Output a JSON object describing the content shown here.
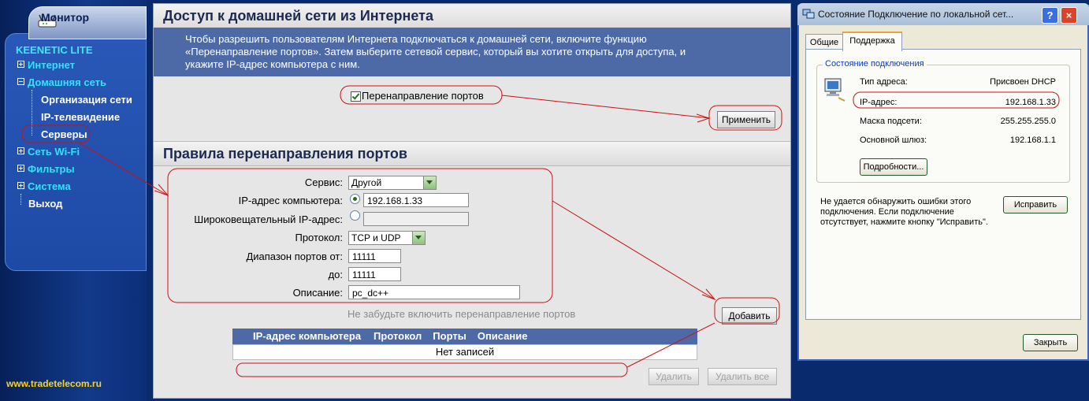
{
  "sidebar": {
    "monitor_label": "Монитор",
    "brand": "KEENETIC LITE",
    "items": [
      {
        "label": "Интернет",
        "expander": "+"
      },
      {
        "label": "Домашняя сеть",
        "expander": "-"
      },
      {
        "label": "Организация сети"
      },
      {
        "label": "IP-телевидение"
      },
      {
        "label": "Серверы"
      },
      {
        "label": "Сеть Wi-Fi",
        "expander": "+"
      },
      {
        "label": "Фильтры",
        "expander": "+"
      },
      {
        "label": "Система",
        "expander": "+"
      },
      {
        "label": "Выход"
      }
    ],
    "site_url": "www.tradetelecom.ru"
  },
  "access": {
    "title": "Доступ к домашней сети из Интернета",
    "intro_lines": [
      "Чтобы разрешить пользователям Интернета подключаться к домашней сети, включите функцию",
      "«Перенаправление портов». Затем выберите сетевой сервис, который вы хотите открыть для доступа, и",
      "укажите IP-адрес компьютера с ним."
    ],
    "port_forward_checkbox_label": "Перенаправление портов",
    "port_forward_checked": true,
    "apply_button": "Применить"
  },
  "rules": {
    "title": "Правила перенаправления портов",
    "service_label": "Сервис:",
    "service_value": "Другой",
    "ip_label": "IP-адрес компьютера:",
    "ip_value": "192.168.1.33",
    "broadcast_label": "Широковещательный IP-адрес:",
    "broadcast_value": "",
    "protocol_label": "Протокол:",
    "protocol_value": "TCP и UDP",
    "port_from_label": "Диапазон портов от:",
    "port_from_value": "11111",
    "port_to_label": "до:",
    "port_to_value": "11111",
    "description_label": "Описание:",
    "description_value": "pc_dc++",
    "hint": "Не забудьте включить перенаправление портов",
    "add_button": "Добавить",
    "table_headers": [
      "IP-адрес компьютера",
      "Протокол",
      "Порты",
      "Описание"
    ],
    "table_empty": "Нет записей",
    "delete_button": "Удалить",
    "delete_all_button": "Удалить все"
  },
  "dialog": {
    "title": "Состояние Подключение по локальной сет...",
    "help_glyph": "?",
    "close_glyph": "×",
    "tabs": [
      "Общие",
      "Поддержка"
    ],
    "active_tab": "Поддержка",
    "group_label": "Состояние подключения",
    "rows": [
      {
        "key": "Тип адреса:",
        "value": "Присвоен DHCP"
      },
      {
        "key": "IP-адрес:",
        "value": "192.168.1.33"
      },
      {
        "key": "Маска подсети:",
        "value": "255.255.255.0"
      },
      {
        "key": "Основной шлюз:",
        "value": "192.168.1.1"
      }
    ],
    "details_button": "Подробности...",
    "repair_text_lines": [
      "Не удается обнаружить ошибки этого",
      "подключения. Если подключение",
      "отсутствует, нажмите кнопку \"Исправить\"."
    ],
    "repair_button": "Исправить",
    "close_button": "Закрыть"
  },
  "colors": {
    "annotation": "#cc1111",
    "header_band": "#4e6aa6",
    "menu_accent": "#36e0ff"
  }
}
